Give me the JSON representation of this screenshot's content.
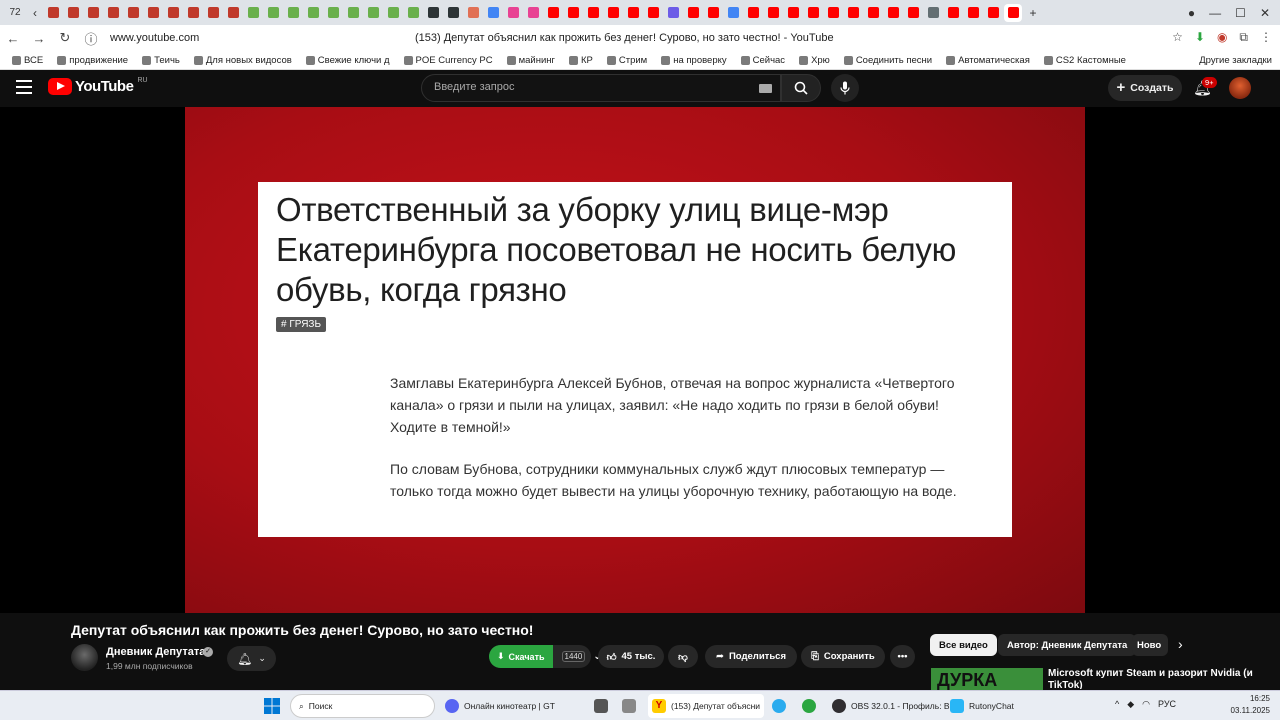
{
  "browser": {
    "tab_count": "72",
    "url": "www.youtube.com",
    "page_title": "(153) Депутат объяснил как прожить без денег! Сурово, но зато честно! - YouTube",
    "tab_favicon_colors": [
      "#c0392b",
      "#c0392b",
      "#c0392b",
      "#c0392b",
      "#c0392b",
      "#c0392b",
      "#c0392b",
      "#c0392b",
      "#c0392b",
      "#c0392b",
      "#6ab04c",
      "#6ab04c",
      "#6ab04c",
      "#6ab04c",
      "#6ab04c",
      "#6ab04c",
      "#6ab04c",
      "#6ab04c",
      "#6ab04c",
      "#2d3436",
      "#2d3436",
      "#e17055",
      "#4285f4",
      "#e84393",
      "#e84393",
      "#ff0000",
      "#ff0000",
      "#ff0000",
      "#ff0000",
      "#ff0000",
      "#ff0000",
      "#6c5ce7",
      "#ff0000",
      "#ff0000",
      "#4285f4",
      "#ff0000",
      "#ff0000",
      "#ff0000",
      "#ff0000",
      "#ff0000",
      "#ff0000",
      "#ff0000",
      "#ff0000",
      "#ff0000",
      "#636e72",
      "#ff0000",
      "#ff0000",
      "#ff0000",
      "#ff0000"
    ],
    "bookmarks": [
      "ВСЕ",
      "продвижение",
      "Теичь",
      "Для новых видосов",
      "Свежие ключи д",
      "POE Currency PC",
      "майнинг",
      "КР",
      "Стрим",
      "на проверку",
      "Сейчас",
      "Хрю",
      "Соединить песни",
      "Автоматическая",
      "CS2 Кастомные"
    ],
    "other_bookmarks": "Другие закладки"
  },
  "youtube": {
    "logo": "YouTube",
    "region": "RU",
    "search_placeholder": "Введите запрос",
    "create_label": "Создать",
    "notif_badge": "9+"
  },
  "video_frame": {
    "headline": "Ответственный за уборку улиц вице-мэр Екатеринбурга посоветовал не носить белую обувь, когда грязно",
    "tag": "# ГРЯЗЬ",
    "para1": "Замглавы Екатеринбурга Алексей Бубнов, отвечая на вопрос журналиста «Четвертого канала» о грязи и пыли на улицах, заявил: «Не надо ходить по грязи в белой обуви! Ходите в темной!»",
    "para2": "По словам Бубнова, сотрудники коммунальных служб ждут плюсовых температур — только тогда можно будет вывести на улицы уборочную технику, работающую на воде."
  },
  "video_info": {
    "title": "Депутат объяснил как прожить без денег! Сурово, но зато честно!",
    "channel": "Дневник Депутата",
    "subscribers": "1,99 млн подписчиков",
    "download_label": "Скачать",
    "download_quality": "1440",
    "likes": "45 тыс.",
    "share_label": "Поделиться",
    "save_label": "Сохранить",
    "more": "•••"
  },
  "recommendations": {
    "chips": [
      "Все видео",
      "Автор: Дневник Депутата",
      "Ново"
    ],
    "thumb_text": "ДУРКА",
    "first_title": "Microsoft купит Steam и разорит Nvidia (и TikTok)"
  },
  "taskbar": {
    "search_placeholder": "Поиск",
    "items": [
      "Онлайн кинотеатр | GT",
      "(153) Депутат объясни",
      "OBS 32.0.1 - Профиль: В",
      "RutonyChat"
    ],
    "lang": "РУС",
    "time": "16:25",
    "date": "03.11.2025"
  }
}
